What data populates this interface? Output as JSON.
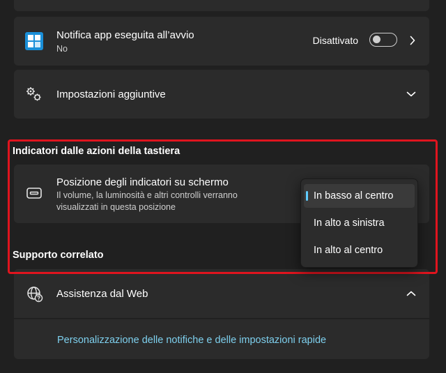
{
  "notification_app": {
    "title": "Notifica app eseguita all’avvio",
    "subtitle": "No",
    "toggle_label": "Disattivato",
    "toggle_on": false,
    "icon": "app-grid-icon"
  },
  "additional_settings": {
    "title": "Impostazioni aggiuntive",
    "icon": "gears-icon"
  },
  "keyboard_indicators": {
    "section_title": "Indicatori dalle azioni della tastiera",
    "position": {
      "title": "Posizione degli indicatori su schermo",
      "description_line1": "Il volume, la luminosità e altri controlli verranno",
      "description_line2": "visualizzati in questa posizione",
      "icon": "screen-indicator-icon"
    },
    "dropdown": {
      "options": [
        "In basso al centro",
        "In alto a sinistra",
        "In alto al centro"
      ],
      "selected": "In basso al centro"
    }
  },
  "related_support": {
    "section_title": "Supporto correlato",
    "web_help": {
      "title": "Assistenza dal Web",
      "icon": "globe-help-icon"
    },
    "link_text": "Personalizzazione delle notifiche e delle impostazioni rapide"
  },
  "colors": {
    "background": "#202020",
    "card": "#2b2b2b",
    "accent": "#60cdff",
    "link": "#7ed0ee",
    "highlight": "#e0141e"
  }
}
